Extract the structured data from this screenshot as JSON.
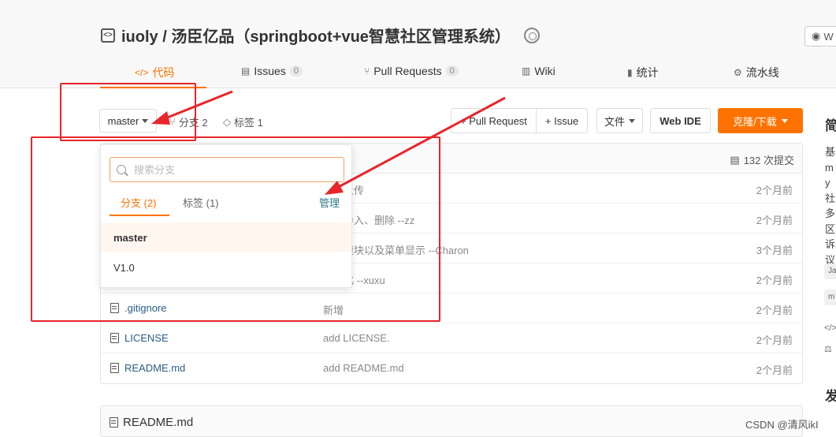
{
  "repo": {
    "title": "iuoly / 汤臣亿品（springboot+vue智慧社区管理系统）",
    "watch_label": "W"
  },
  "tabs": [
    {
      "label": "代码",
      "icon": "code-icon",
      "active": true
    },
    {
      "label": "Issues",
      "count": "0",
      "icon": "issue-icon"
    },
    {
      "label": "Pull Requests",
      "count": "0",
      "icon": "pull-request-icon"
    },
    {
      "label": "Wiki",
      "icon": "book-icon"
    },
    {
      "label": "统计",
      "icon": "bar-chart-icon"
    },
    {
      "label": "流水线",
      "icon": "pipeline-icon"
    }
  ],
  "toolbar": {
    "branch": "master",
    "branch_count": "分支 2",
    "tag_count": "标签 1",
    "pull_request": "+ Pull Request",
    "issue": "+ Issue",
    "file": "文件",
    "web_ide": "Web IDE",
    "clone": "克隆/下载"
  },
  "commits": {
    "count": "132 次提交"
  },
  "files": [
    {
      "name": "",
      "message": "件已上传",
      "time": "2个月前"
    },
    {
      "name": "",
      "message": "信息导入、删除 --zz",
      "time": "2个月前"
    },
    {
      "name": "",
      "message": "登录模块以及菜单显示 --Charon",
      "time": "3个月前"
    },
    {
      "name": "",
      "message": "的优化 --xuxu",
      "time": "2个月前"
    },
    {
      "name": ".gitignore",
      "message": "新增",
      "time": "2个月前"
    },
    {
      "name": "LICENSE",
      "message": "add LICENSE.",
      "time": "2个月前"
    },
    {
      "name": "README.md",
      "message": "add README.md",
      "time": "2个月前"
    }
  ],
  "readme": {
    "title": "README.md"
  },
  "dropdown": {
    "search_placeholder": "搜索分支",
    "tab_branches": "分支 (2)",
    "tab_tags": "标签 (1)",
    "manage": "管理",
    "branches": [
      "master",
      "V1.0"
    ]
  },
  "sidebar": {
    "heading": "简",
    "text": "基my社多区诉议",
    "tags": [
      "Ja",
      "m"
    ],
    "heading2": "发"
  },
  "watermark": "CSDN @清风ikI",
  "colors": {
    "accent": "#fe7300",
    "annotation": "#e8252a",
    "link": "#2a5d88"
  }
}
